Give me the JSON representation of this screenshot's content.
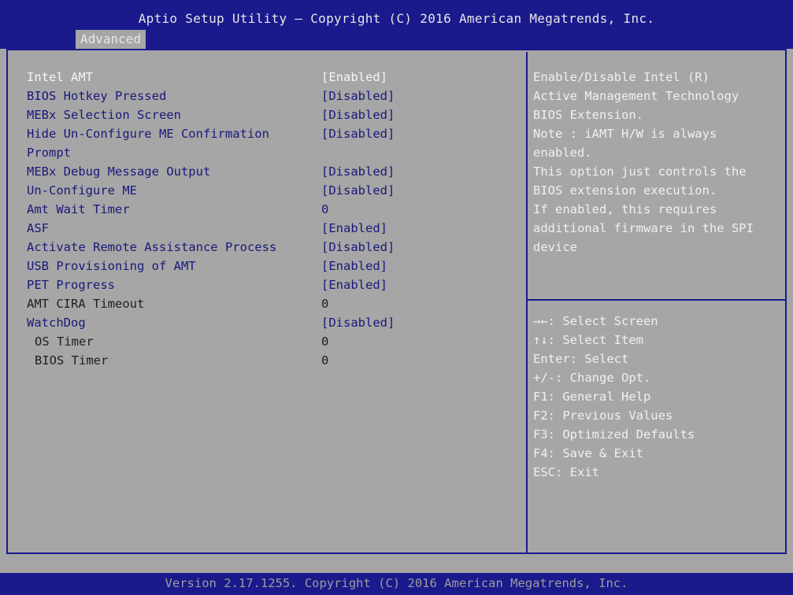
{
  "header": {
    "title": "Aptio Setup Utility – Copyright (C) 2016 American Megatrends, Inc.",
    "tab": "Advanced"
  },
  "settings": [
    {
      "label": "Intel AMT",
      "value": "[Enabled]"
    },
    {
      "label": "BIOS Hotkey Pressed",
      "value": "[Disabled]"
    },
    {
      "label": "MEBx Selection Screen",
      "value": "[Disabled]"
    },
    {
      "label": "Hide Un-Configure ME Confirmation",
      "label2": "Prompt",
      "value": "[Disabled]"
    },
    {
      "label": "MEBx Debug Message Output",
      "value": "[Disabled]"
    },
    {
      "label": "Un-Configure ME",
      "value": "[Disabled]"
    },
    {
      "label": "Amt Wait Timer",
      "value": "0"
    },
    {
      "label": "ASF",
      "value": "[Enabled]"
    },
    {
      "label": "Activate Remote Assistance Process",
      "value": "[Disabled]"
    },
    {
      "label": "USB Provisioning of AMT",
      "value": "[Enabled]"
    },
    {
      "label": "PET Progress",
      "value": "[Enabled]"
    },
    {
      "label": "AMT CIRA Timeout",
      "value": "0"
    },
    {
      "label": "WatchDog",
      "value": "[Disabled]"
    },
    {
      "label": "OS Timer",
      "value": "0"
    },
    {
      "label": "BIOS Timer",
      "value": "0"
    }
  ],
  "help_text": "Enable/Disable Intel (R)\nActive Management Technology\nBIOS Extension.\nNote : iAMT H/W is always\nenabled.\nThis option just controls the\nBIOS extension execution.\nIf enabled, this requires\nadditional firmware in the SPI\ndevice",
  "key_help": [
    "→←: Select Screen",
    "↑↓: Select Item",
    "Enter: Select",
    "+/-: Change Opt.",
    "F1: General Help",
    "F2: Previous Values",
    "F3: Optimized Defaults",
    "F4: Save & Exit",
    "ESC: Exit"
  ],
  "footer": "Version 2.17.1255. Copyright (C) 2016 American Megatrends, Inc.",
  "colors": {
    "background": "#a6a6a6",
    "bar": "#1a1a8c",
    "selected": "#f5f5f5",
    "option_text": "#19197a"
  }
}
